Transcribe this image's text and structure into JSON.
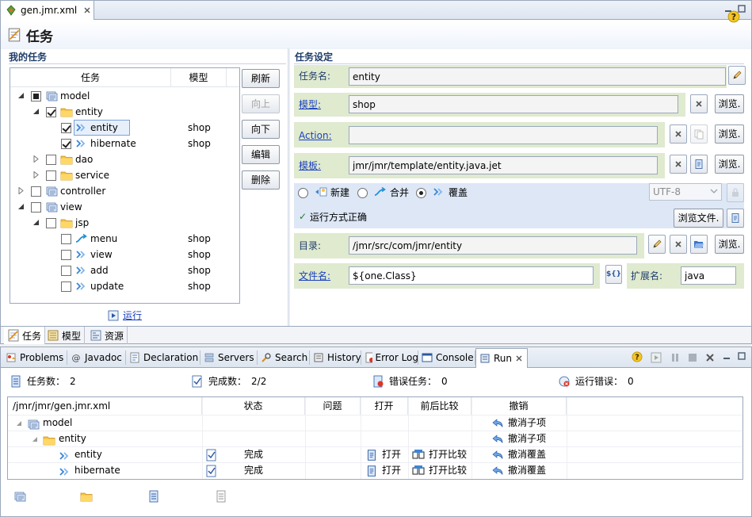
{
  "editor": {
    "tab_label": "gen.jmr.xml",
    "form_title": "任务"
  },
  "tasks_panel": {
    "title": "我的任务",
    "columns": [
      "任务",
      "模型"
    ],
    "tree": [
      {
        "label": "model",
        "model": "",
        "check": "partial",
        "expand": "open",
        "icon": "model-icon",
        "level": 0
      },
      {
        "label": "entity",
        "model": "",
        "check": "checked",
        "expand": "open",
        "icon": "folder-icon",
        "level": 1
      },
      {
        "label": "entity",
        "model": "shop",
        "check": "checked",
        "expand": "none",
        "icon": "overwrite-icon",
        "level": 2,
        "selected": true
      },
      {
        "label": "hibernate",
        "model": "shop",
        "check": "checked",
        "expand": "none",
        "icon": "overwrite-icon",
        "level": 2
      },
      {
        "label": "dao",
        "model": "",
        "check": "unchecked",
        "expand": "closed",
        "icon": "folder-icon",
        "level": 1
      },
      {
        "label": "service",
        "model": "",
        "check": "unchecked",
        "expand": "closed",
        "icon": "folder-icon",
        "level": 1
      },
      {
        "label": "controller",
        "model": "",
        "check": "unchecked",
        "expand": "closed",
        "icon": "model-icon",
        "level": 0
      },
      {
        "label": "view",
        "model": "",
        "check": "unchecked",
        "expand": "open",
        "icon": "model-icon",
        "level": 0
      },
      {
        "label": "jsp",
        "model": "",
        "check": "unchecked",
        "expand": "open",
        "icon": "folder-icon",
        "level": 1
      },
      {
        "label": "menu",
        "model": "shop",
        "check": "unchecked",
        "expand": "none",
        "icon": "merge-icon",
        "level": 2
      },
      {
        "label": "view",
        "model": "shop",
        "check": "unchecked",
        "expand": "none",
        "icon": "overwrite-icon",
        "level": 2
      },
      {
        "label": "add",
        "model": "shop",
        "check": "unchecked",
        "expand": "none",
        "icon": "overwrite-icon",
        "level": 2
      },
      {
        "label": "update",
        "model": "shop",
        "check": "unchecked",
        "expand": "none",
        "icon": "overwrite-icon",
        "level": 2
      }
    ],
    "buttons": {
      "refresh": "刷新",
      "up": "向上",
      "down": "向下",
      "edit": "编辑",
      "delete": "删除"
    },
    "run_link": "运行"
  },
  "settings": {
    "title": "任务设定",
    "task_name_label": "任务名:",
    "task_name_value": "entity",
    "model_label": "模型:",
    "model_value": "shop",
    "action_label": "Action:",
    "action_value": "",
    "template_label": "模板:",
    "template_value": "jmr/jmr/template/entity.java.jet",
    "mode_new": "新建",
    "mode_merge": "合并",
    "mode_overwrite": "覆盖",
    "mode_selected": "overwrite",
    "encoding": "UTF-8",
    "validation_msg": "运行方式正确",
    "browse_files": "浏览文件.",
    "dir_label": "目录:",
    "dir_value": "/jmr/src/com/jmr/entity",
    "filename_label": "文件名:",
    "filename_value": "${one.Class}",
    "ext_label": "扩展名:",
    "ext_value": "java",
    "browse": "浏览.",
    "vars_button": "${}"
  },
  "editor_bottom_tabs": [
    "任务",
    "模型",
    "资源"
  ],
  "view_tabs": [
    {
      "label": "Problems",
      "icon": "problems-icon"
    },
    {
      "label": "Javadoc",
      "icon": "javadoc-icon"
    },
    {
      "label": "Declaration",
      "icon": "declaration-icon"
    },
    {
      "label": "Servers",
      "icon": "servers-icon"
    },
    {
      "label": "Search",
      "icon": "search-icon"
    },
    {
      "label": "History",
      "icon": "history-icon"
    },
    {
      "label": "Error Log",
      "icon": "error-log-icon"
    },
    {
      "label": "Console",
      "icon": "console-icon"
    },
    {
      "label": "Run",
      "icon": "run-view-icon"
    }
  ],
  "run_stats": {
    "task_count_label": "任务数：",
    "task_count": "2",
    "done_label": "完成数：",
    "done": "2/2",
    "error_tasks_label": "错误任务：",
    "error_tasks": "0",
    "run_errors_label": "运行错误：",
    "run_errors": "0"
  },
  "results_table": {
    "columns": [
      "/jmr/jmr/gen.jmr.xml",
      "状态",
      "问题",
      "打开",
      "前后比较",
      "撤销"
    ],
    "rows": [
      {
        "name": "model",
        "status": "",
        "open": "",
        "compare": "",
        "undo": "撤消子项",
        "icon": "model-icon",
        "level": 0
      },
      {
        "name": "entity",
        "status": "",
        "open": "",
        "compare": "",
        "undo": "撤消子项",
        "icon": "folder-icon",
        "level": 1
      },
      {
        "name": "entity",
        "status": "完成",
        "open": "打开",
        "compare": "打开比较",
        "undo": "撤消覆盖",
        "icon": "overwrite-icon",
        "level": 2
      },
      {
        "name": "hibernate",
        "status": "完成",
        "open": "打开",
        "compare": "打开比较",
        "undo": "撤消覆盖",
        "icon": "overwrite-icon",
        "level": 2
      }
    ]
  },
  "colors": {
    "accent_link": "#1a3fbf",
    "row_green": "#dfeacf",
    "row_blue": "#dde7f6",
    "section_title": "#1f3d6b"
  }
}
